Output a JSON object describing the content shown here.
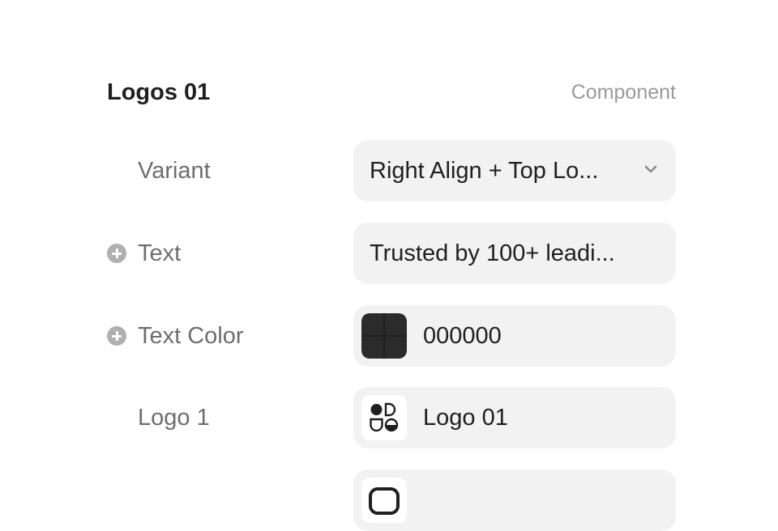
{
  "panel": {
    "title": "Logos 01",
    "kind": "Component"
  },
  "rows": [
    {
      "label": "Variant",
      "value": "Right Align + Top Lo...",
      "has_add_icon": false,
      "control": "dropdown"
    },
    {
      "label": "Text",
      "value": "Trusted by 100+ leadi...",
      "has_add_icon": true,
      "control": "text"
    },
    {
      "label": "Text Color",
      "value": "000000",
      "swatch_color": "#2b2b2b",
      "has_add_icon": true,
      "control": "color"
    },
    {
      "label": "Logo 1",
      "value": "Logo 01",
      "icon": "logo-01-icon",
      "has_add_icon": false,
      "control": "component-instance"
    }
  ],
  "colors": {
    "control_bg": "#f2f2f2",
    "label": "#6e6e6e",
    "muted": "#9a9a9a",
    "text": "#1f1f1f"
  }
}
